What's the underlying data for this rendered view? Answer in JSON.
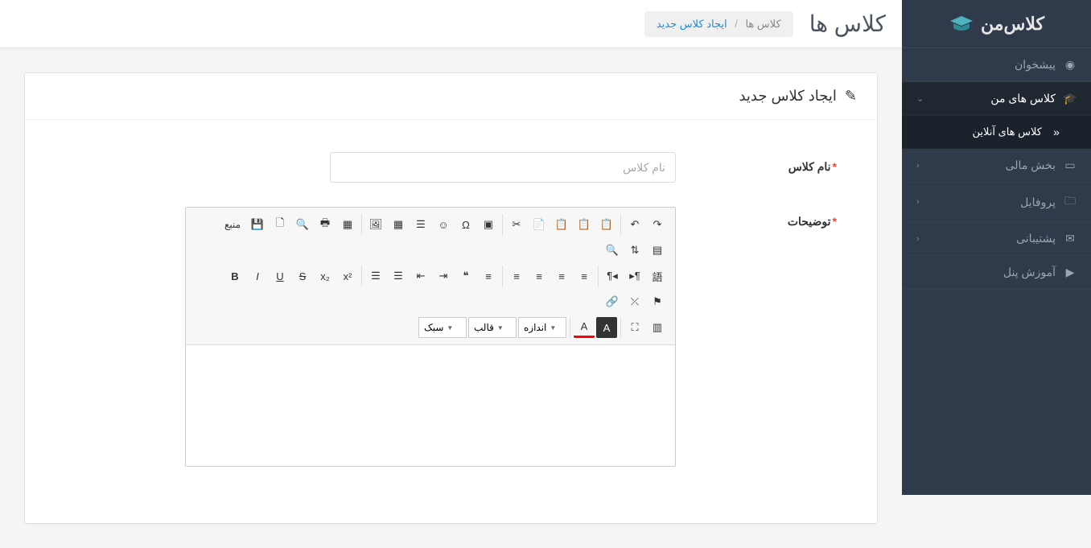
{
  "logo": {
    "text": "کلاس‌من"
  },
  "sidebar": {
    "items": [
      {
        "label": "پیشخوان",
        "icon": "dashboard"
      },
      {
        "label": "کلاس های من",
        "icon": "grad-cap",
        "active": true,
        "expandable": true
      },
      {
        "label": "کلاس های آنلاین",
        "icon": "dbl-arrow",
        "sub": true
      },
      {
        "label": "بخش مالی",
        "icon": "money",
        "expandable": true
      },
      {
        "label": "پروفایل",
        "icon": "folder",
        "expandable": true
      },
      {
        "label": "پشتیبانی",
        "icon": "chat",
        "expandable": true
      },
      {
        "label": "آموزش پنل",
        "icon": "video"
      }
    ]
  },
  "header": {
    "title": "کلاس ها",
    "breadcrumb": {
      "root": "کلاس ها",
      "current": "ایجاد کلاس جدید"
    }
  },
  "panel": {
    "title": "ایجاد کلاس جدید",
    "fields": {
      "name": {
        "label": "نام کلاس",
        "placeholder": "نام کلاس"
      },
      "desc": {
        "label": "توضیحات"
      }
    }
  },
  "editor": {
    "source_label": "منبع",
    "combos": {
      "style": "سبک",
      "format": "قالب",
      "size": "اندازه"
    }
  }
}
